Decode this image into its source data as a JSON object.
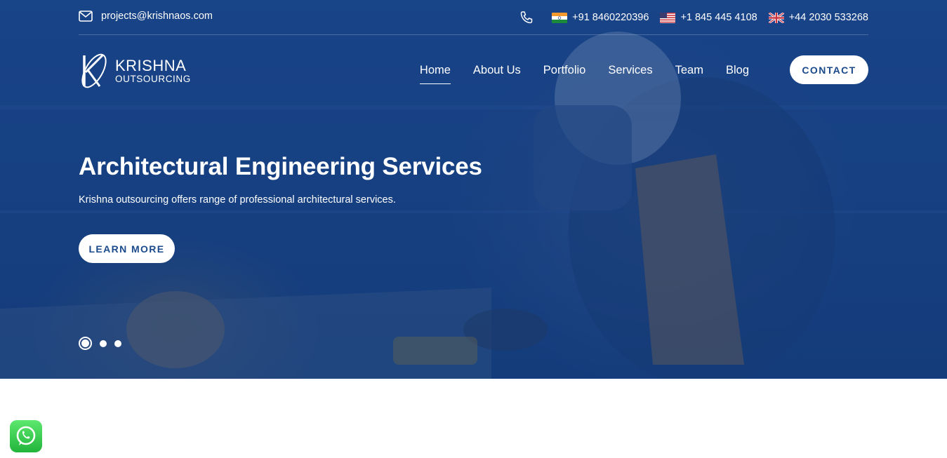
{
  "topbar": {
    "email": "projects@krishnaos.com",
    "phones": [
      {
        "flag": "india-flag-icon",
        "number": "+91 8460220396"
      },
      {
        "flag": "usa-flag-icon",
        "number": "+1 845 445 4108"
      },
      {
        "flag": "uk-flag-icon",
        "number": "+44 2030 533268"
      }
    ]
  },
  "logo": {
    "name": "KRISHNA",
    "sub": "OUTSOURCING"
  },
  "nav": {
    "items": [
      "Home",
      "About Us",
      "Portfolio",
      "Services",
      "Team",
      "Blog"
    ],
    "active": "Home",
    "contact_label": "CONTACT"
  },
  "hero": {
    "title": "Architectural Engineering Services",
    "subtitle": "Krishna outsourcing offers range of professional architectural services.",
    "cta_label": "LEARN MORE",
    "slides": 3,
    "active_slide": 1
  },
  "colors": {
    "primary": "#1b4a8c",
    "whatsapp": "#25d366"
  },
  "icons": {
    "email": "mail-icon",
    "phone": "phone-icon",
    "chat": "whatsapp-icon"
  }
}
